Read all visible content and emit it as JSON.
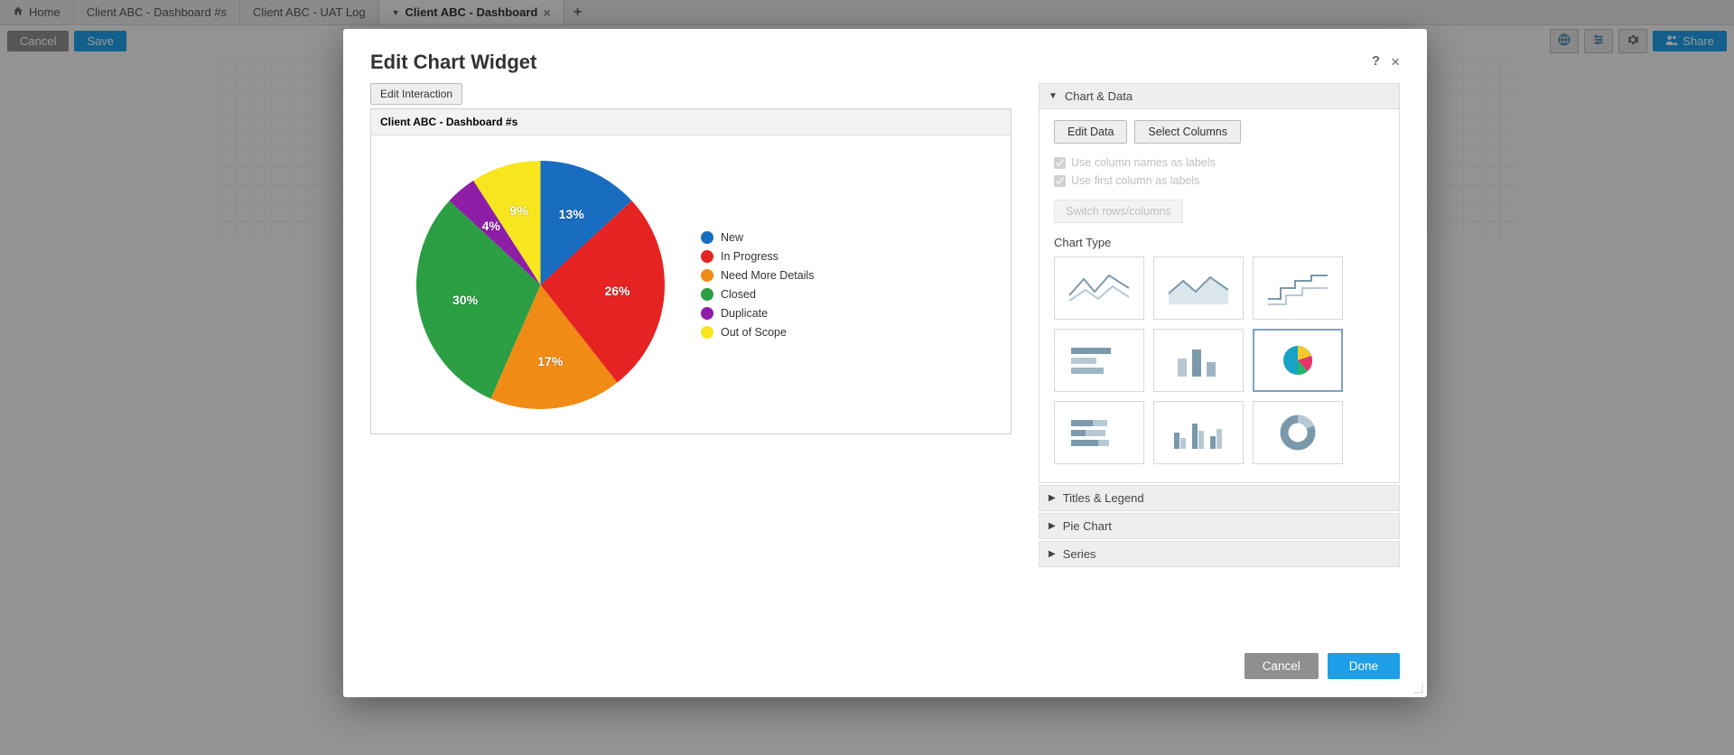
{
  "tabs": [
    {
      "label": "Home",
      "icon": "home"
    },
    {
      "label": "Client ABC - Dashboard #s"
    },
    {
      "label": "Client ABC - UAT Log"
    },
    {
      "label": "Client ABC - Dashboard",
      "active": true,
      "closable": true
    }
  ],
  "toolbar": {
    "cancel": "Cancel",
    "save": "Save",
    "share": "Share"
  },
  "modal": {
    "title": "Edit Chart Widget",
    "edit_interaction": "Edit Interaction",
    "chart_title": "Client ABC - Dashboard #s",
    "cancel": "Cancel",
    "done": "Done"
  },
  "panel": {
    "sec_chart_data": "Chart & Data",
    "edit_data": "Edit Data",
    "select_columns": "Select Columns",
    "use_col_names": "Use column names as labels",
    "use_first_col": "Use first column as labels",
    "switch_rc": "Switch rows/columns",
    "chart_type_label": "Chart Type",
    "sec_titles": "Titles & Legend",
    "sec_pie": "Pie Chart",
    "sec_series": "Series"
  },
  "chart_data": {
    "type": "pie",
    "title": "Client ABC - Dashboard #s",
    "series": [
      {
        "name": "New",
        "value": 13,
        "label": "13%",
        "color": "#196dc1"
      },
      {
        "name": "In Progress",
        "value": 26,
        "label": "26%",
        "color": "#e62323"
      },
      {
        "name": "Need More Details",
        "value": 17,
        "label": "17%",
        "color": "#f08b16"
      },
      {
        "name": "Closed",
        "value": 30,
        "label": "30%",
        "color": "#2c9f45"
      },
      {
        "name": "Duplicate",
        "value": 4,
        "label": "4%",
        "color": "#8e1ea8"
      },
      {
        "name": "Out of Scope",
        "value": 9,
        "label": "9%",
        "color": "#f7e61e"
      }
    ]
  },
  "chart_types": [
    {
      "id": "line",
      "selected": false
    },
    {
      "id": "area",
      "selected": false
    },
    {
      "id": "step",
      "selected": false
    },
    {
      "id": "hbar",
      "selected": false
    },
    {
      "id": "vbar",
      "selected": false
    },
    {
      "id": "pie",
      "selected": true
    },
    {
      "id": "hbar-stack",
      "selected": false
    },
    {
      "id": "vbar-group",
      "selected": false
    },
    {
      "id": "donut",
      "selected": false
    }
  ]
}
